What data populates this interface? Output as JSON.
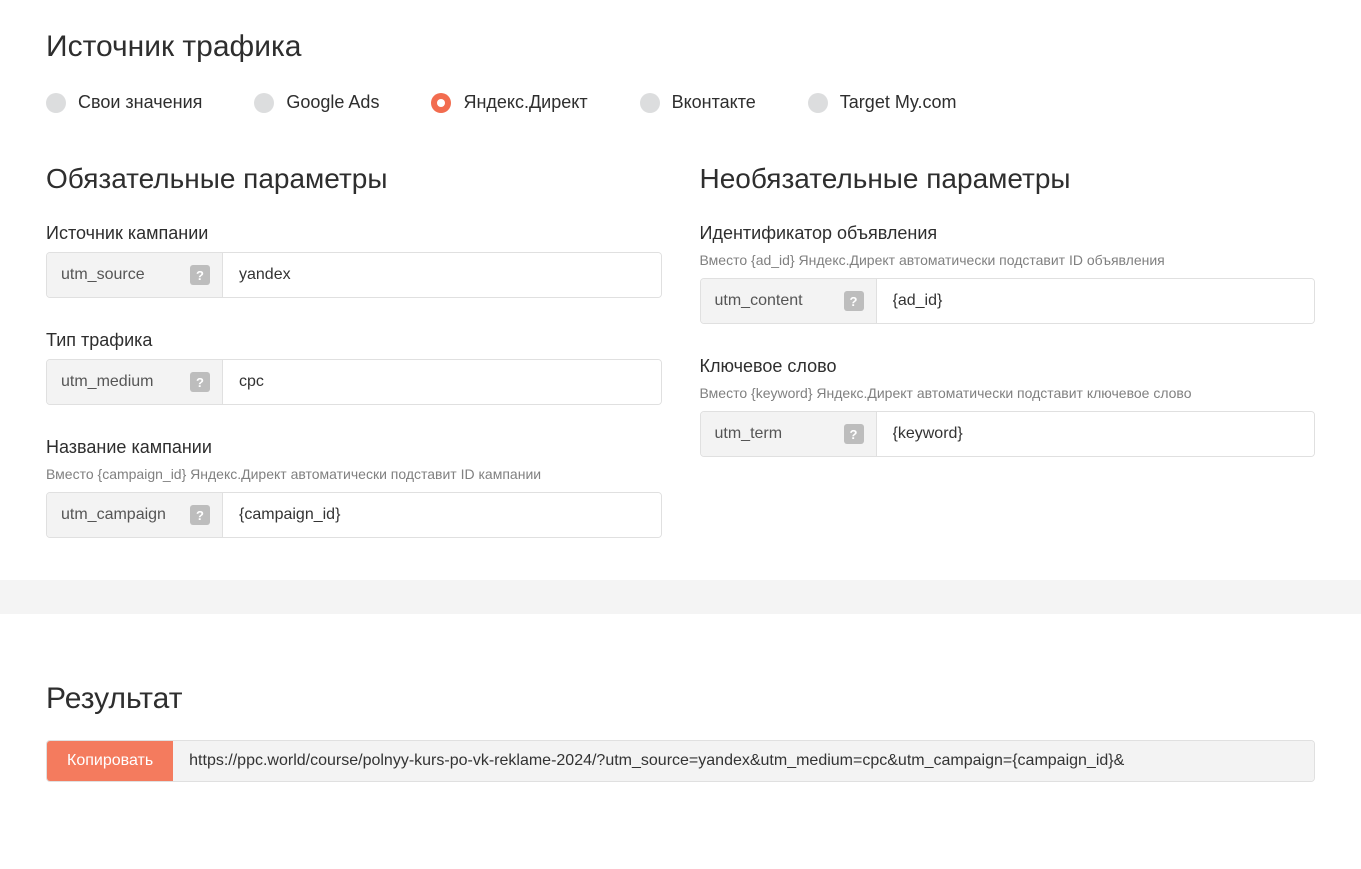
{
  "traffic": {
    "title": "Источник трафика",
    "options": [
      {
        "label": "Свои значения",
        "active": false
      },
      {
        "label": "Google Ads",
        "active": false
      },
      {
        "label": "Яндекс.Директ",
        "active": true
      },
      {
        "label": "Вконтакте",
        "active": false
      },
      {
        "label": "Target My.com",
        "active": false
      }
    ]
  },
  "required": {
    "title": "Обязательные параметры",
    "source": {
      "label": "Источник кампании",
      "param": "utm_source",
      "value": "yandex",
      "help": "?"
    },
    "medium": {
      "label": "Тип трафика",
      "param": "utm_medium",
      "value": "cpc",
      "help": "?"
    },
    "campaign": {
      "label": "Название кампании",
      "hint": "Вместо {campaign_id} Яндекс.Директ автоматически подставит ID кампании",
      "param": "utm_campaign",
      "value": "{campaign_id}",
      "help": "?"
    }
  },
  "optional": {
    "title": "Необязательные параметры",
    "content": {
      "label": "Идентификатор объявления",
      "hint": "Вместо {ad_id} Яндекс.Директ автоматически подставит ID объявления",
      "param": "utm_content",
      "value": "{ad_id}",
      "help": "?"
    },
    "term": {
      "label": "Ключевое слово",
      "hint": "Вместо {keyword} Яндекс.Директ автоматически подставит ключевое слово",
      "param": "utm_term",
      "value": "{keyword}",
      "help": "?"
    }
  },
  "result": {
    "title": "Результат",
    "copy_label": "Копировать",
    "url": "https://ppc.world/course/polnyy-kurs-po-vk-reklame-2024/?utm_source=yandex&utm_medium=cpc&utm_campaign={campaign_id}&"
  }
}
